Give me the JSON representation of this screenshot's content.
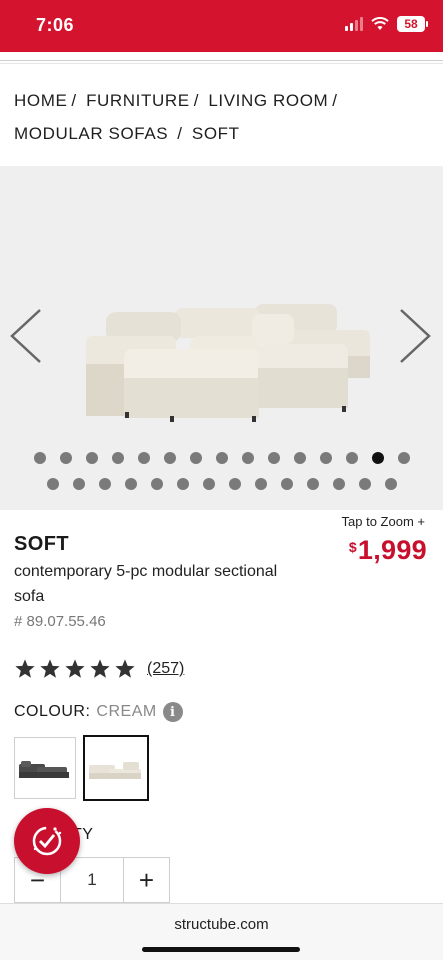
{
  "status": {
    "time": "7:06",
    "battery": "58"
  },
  "breadcrumb": {
    "items": [
      "HOME",
      "FURNITURE",
      "LIVING ROOM",
      "MODULAR SOFAS",
      "SOFT"
    ],
    "separator": "/"
  },
  "gallery": {
    "total_images": 29,
    "active_index": 13
  },
  "product": {
    "tap_to_zoom": "Tap to Zoom +",
    "price_currency": "$",
    "price_amount": "1,999",
    "name": "SOFT",
    "description": "contemporary 5-pc modular sectional sofa",
    "sku": "# 89.07.55.46",
    "rating": 5,
    "reviews": "(257)",
    "colour_label": "COLOUR:",
    "colour_value": "CREAM",
    "colours": [
      "dark grey",
      "cream"
    ],
    "selected_colour_index": 1
  },
  "quantity": {
    "label": "QUANTITY",
    "label_visible": "TY",
    "value": "1",
    "minus": "−",
    "plus": "+"
  },
  "browser": {
    "url": "structube.com"
  },
  "colors": {
    "brand_red": "#d4142f",
    "price_red": "#c8102e"
  }
}
